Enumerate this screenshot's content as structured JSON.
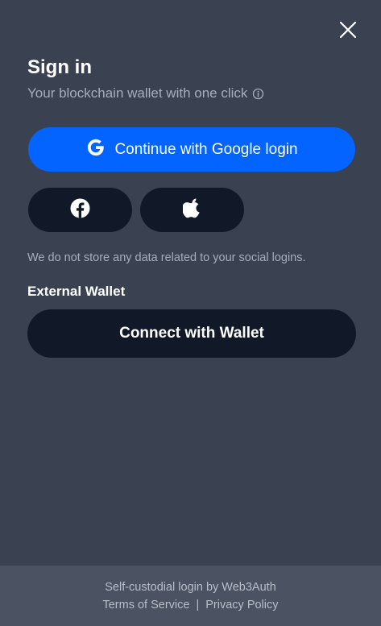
{
  "header": {
    "title": "Sign in",
    "subtitle": "Your blockchain wallet with one click"
  },
  "buttons": {
    "google_label": "Continue with Google login",
    "connect_wallet_label": "Connect with Wallet"
  },
  "notice": "We do not store any data related to your social logins.",
  "external_wallet_label": "External Wallet",
  "footer": {
    "powered_by": "Self-custodial login by Web3Auth",
    "terms": "Terms of Service",
    "separator": "|",
    "privacy": "Privacy Policy"
  },
  "icons": {
    "close": "close-icon",
    "info": "info-icon",
    "google": "google-icon",
    "facebook": "facebook-icon",
    "apple": "apple-icon"
  },
  "colors": {
    "background": "#3a4252",
    "primary": "#0364ff",
    "dark_button": "#111827",
    "footer_bg": "#4b5363",
    "muted_text": "#a7adba"
  }
}
